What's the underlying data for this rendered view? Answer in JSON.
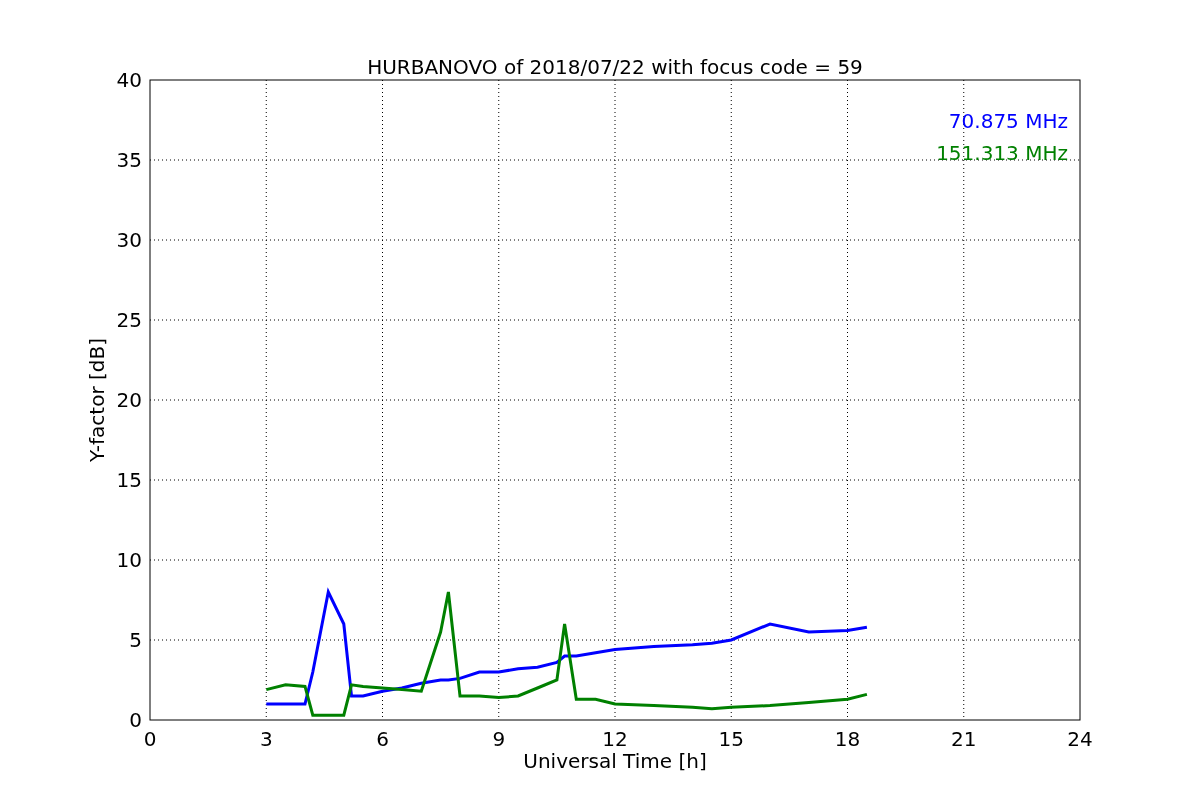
{
  "chart_data": {
    "type": "line",
    "title": "HURBANOVO of 2018/07/22 with focus code = 59",
    "xlabel": "Universal Time [h]",
    "ylabel": "Y-factor [dB]",
    "x": [
      3,
      3.5,
      4,
      4.2,
      4.6,
      5,
      5.2,
      5.5,
      6,
      6.5,
      7,
      7.5,
      7.7,
      8,
      8.5,
      9,
      9.5,
      10,
      10.5,
      10.7,
      11,
      11.5,
      12,
      13,
      14,
      14.5,
      15,
      16,
      17,
      18,
      18.5
    ],
    "series": [
      {
        "name": "70.875 MHz",
        "color": "#0000ff",
        "values": [
          1,
          1,
          1,
          3,
          8,
          6,
          1.5,
          1.5,
          1.8,
          2,
          2.3,
          2.5,
          2.5,
          2.6,
          3,
          3,
          3.2,
          3.3,
          3.6,
          4,
          4,
          4.2,
          4.4,
          4.6,
          4.7,
          4.8,
          5,
          6,
          5.5,
          5.6,
          5.8
        ]
      },
      {
        "name": "151.313 MHz",
        "color": "#008000",
        "values": [
          1.9,
          2.2,
          2.1,
          0.3,
          0.3,
          0.3,
          2.2,
          2.1,
          2,
          1.9,
          1.8,
          5.5,
          8,
          1.5,
          1.5,
          1.4,
          1.5,
          2,
          2.5,
          6,
          1.3,
          1.3,
          1,
          0.9,
          0.8,
          0.7,
          0.8,
          0.9,
          1.1,
          1.3,
          1.6
        ]
      }
    ],
    "grid": true,
    "xlim": [
      0,
      24
    ],
    "ylim": [
      0,
      40
    ],
    "xticks": [
      0,
      3,
      6,
      9,
      12,
      15,
      18,
      21,
      24
    ],
    "yticks": [
      0,
      5,
      10,
      15,
      20,
      25,
      30,
      35,
      40
    ]
  }
}
